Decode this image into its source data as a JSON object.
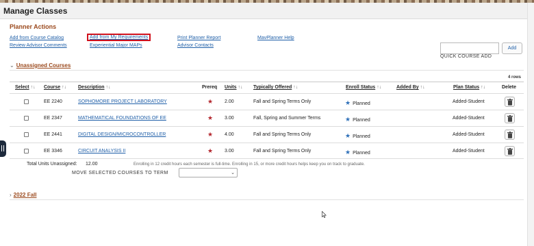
{
  "page": {
    "title": "Manage Classes"
  },
  "planner_actions": {
    "heading": "Planner Actions",
    "links": {
      "add_from_catalog": "Add from Course Catalog",
      "review_advisor_comments": "Review Advisor Comments",
      "add_from_requirements": "Add from My Requirements",
      "experiential_major_maps": "Experiential Major MAPs",
      "print_planner_report": "Print Planner Report",
      "advisor_contacts": "Advisor Contacts",
      "mavplanner_help": "MavPlanner Help"
    }
  },
  "quick_course": {
    "value": "",
    "add_label": "Add",
    "label": "QUICK COURSE ADD"
  },
  "unassigned": {
    "heading": "Unassigned Courses",
    "row_count": "4 rows",
    "columns": {
      "select": "Select",
      "course": "Course",
      "description": "Description",
      "prereq": "Prereq",
      "units": "Units",
      "typically_offered": "Typically Offered",
      "enroll_status": "Enroll Status",
      "added_by": "Added By",
      "plan_status": "Plan Status",
      "delete": "Delete"
    },
    "rows": [
      {
        "course": "EE 2240",
        "description": "SOPHOMORE PROJECT LABORATORY",
        "units": "2.00",
        "offered": "Fall and Spring Terms Only",
        "enroll_status": "Planned",
        "added_by": "",
        "plan_status": "Added-Student"
      },
      {
        "course": "EE 2347",
        "description": "MATHEMATICAL FOUNDATIONS OF EE",
        "units": "3.00",
        "offered": "Fall, Spring and Summer Terms",
        "enroll_status": "Planned",
        "added_by": "",
        "plan_status": "Added-Student"
      },
      {
        "course": "EE 2441",
        "description": "DIGITAL DESIGN/MICROCONTROLLER",
        "units": "4.00",
        "offered": "Fall and Spring Terms Only",
        "enroll_status": "Planned",
        "added_by": "",
        "plan_status": "Added-Student"
      },
      {
        "course": "EE 3346",
        "description": "CIRCUIT ANALYSIS II",
        "units": "3.00",
        "offered": "Fall and Spring Terms Only",
        "enroll_status": "Planned",
        "added_by": "",
        "plan_status": "Added-Student"
      }
    ],
    "total_label": "Total Units Unassigned:",
    "total_value": "12.00",
    "total_note": "Enrolling in 12 credit hours each semester is full-time. Enrolling in 15, or more credit hours helps keep you on track to graduate.",
    "move_label": "MOVE SELECTED COURSES TO TERM",
    "move_value": ""
  },
  "term_2022_fall": {
    "heading": "2022 Fall"
  },
  "colors": {
    "accent": "#9b4a1e",
    "link": "#1f5fa8",
    "prereq_star": "#b3262d",
    "status_star": "#2d6fb8",
    "highlight": "#d0101c"
  }
}
